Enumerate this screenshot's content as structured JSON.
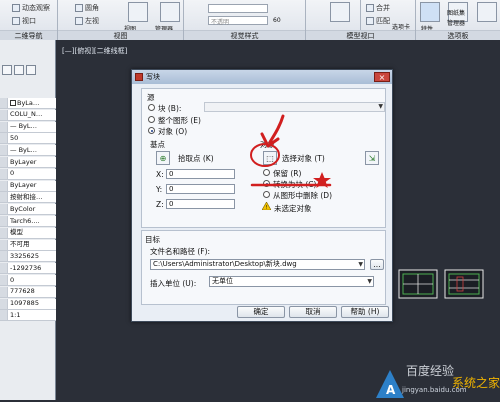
{
  "ribbon": {
    "row1_a": "动态观察",
    "row1_b": "圆角",
    "row1_c": "合并",
    "row1_d": "特性",
    "row1_e": "图纸集",
    "row2_a": "视口",
    "row2_b": "左视",
    "row2_c": "视图",
    "row2_d": "管理器",
    "row2_e": "不透明",
    "row2_f": "60",
    "row2_g": "选项卡",
    "row2_h": "匹配",
    "row2_i": "管理器",
    "panel_nav": "二维导航",
    "panel_view": "视图",
    "panel_visual": "视觉样式",
    "panel_model": "模型视口",
    "panel_options": "选项板"
  },
  "palette": {
    "rows": [
      "ByLa…",
      "COLU_N…",
      "— ByL…",
      "50",
      "— ByL…",
      "ByLayer",
      "0",
      "ByLayer",
      "按射和接…",
      "ByColor",
      "Tarch6.…",
      "模型",
      "不可用",
      "3325625",
      "-1292736",
      "0",
      "777628",
      "1097885",
      "1:1"
    ],
    "cut_labels": [
      "质",
      "质",
      "线",
      "建"
    ]
  },
  "viewport": {
    "label": "[—][俯视][二维线框]"
  },
  "dialog": {
    "title": "写块",
    "close": "×",
    "source": {
      "heading": "源",
      "block": "块 (B):",
      "whole": "整个图形 (E)",
      "objects": "对象 (O)"
    },
    "base_point": {
      "heading": "基点",
      "pick": "拾取点 (K)",
      "x_label": "X:",
      "x": "0",
      "y_label": "Y:",
      "y": "0",
      "z_label": "Z:",
      "z": "0"
    },
    "objects": {
      "heading": "对象",
      "select": "选择对象 (T)",
      "retain": "保留 (R)",
      "convert": "转换为块 (C)",
      "delete": "从图形中删除 (D)",
      "warning": "未选定对象"
    },
    "target": {
      "heading": "目标",
      "path_label": "文件名和路径 (F):",
      "path": "C:\\Users\\Administrator\\Desktop\\新块.dwg",
      "browse": "...",
      "units_label": "插入单位 (U):",
      "units": "无单位"
    },
    "buttons": {
      "ok": "确定",
      "cancel": "取消",
      "help": "帮助 (H)"
    }
  },
  "watermark": {
    "site": "jingyan.baidu.com",
    "brand": "百度经验",
    "brand2": "系统之家"
  },
  "colors": {
    "background": "#2b2f38",
    "accent_red": "#d11f1f",
    "dialog": "#e9eef5"
  }
}
